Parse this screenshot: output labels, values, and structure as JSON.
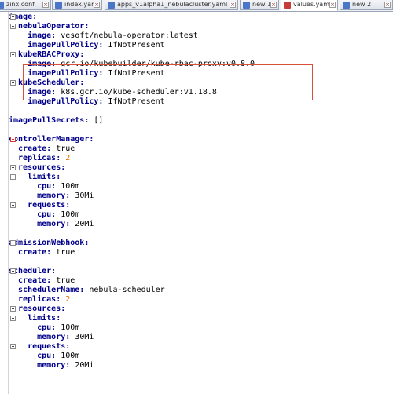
{
  "tabs": [
    {
      "label": "zinx.conf",
      "active": false
    },
    {
      "label": "index.yaml",
      "active": false
    },
    {
      "label": "apps_v1alpha1_nebulacluster.yaml",
      "active": false
    },
    {
      "label": "new 1",
      "active": false
    },
    {
      "label": "values.yaml",
      "active": true
    },
    {
      "label": "new 2",
      "active": false
    }
  ],
  "code_lines": [
    [
      {
        "t": "image:",
        "c": "k"
      }
    ],
    [
      {
        "t": "  nebulaOperator:",
        "c": "k"
      }
    ],
    [
      {
        "t": "    image:",
        "c": "k"
      },
      {
        "t": " vesoft/nebula-operator:latest",
        "c": "s"
      }
    ],
    [
      {
        "t": "    imagePullPolicy:",
        "c": "k"
      },
      {
        "t": " IfNotPresent",
        "c": "s"
      }
    ],
    [
      {
        "t": "  kubeRBACProxy:",
        "c": "k"
      }
    ],
    [
      {
        "t": "    image:",
        "c": "k"
      },
      {
        "t": " gcr.io/kubebuilder/kube-rbac-proxy:v0.8.0",
        "c": "s"
      }
    ],
    [
      {
        "t": "    imagePullPolicy:",
        "c": "k"
      },
      {
        "t": " IfNotPresent",
        "c": "s"
      }
    ],
    [
      {
        "t": "  kubeScheduler:",
        "c": "k"
      }
    ],
    [
      {
        "t": "    image:",
        "c": "k"
      },
      {
        "t": " k8s.gcr.io/kube-scheduler:v1.18.8",
        "c": "s"
      }
    ],
    [
      {
        "t": "    imagePullPolicy:",
        "c": "k"
      },
      {
        "t": " IfNotPresent",
        "c": "s"
      }
    ],
    [],
    [
      {
        "t": "imagePullSecrets:",
        "c": "k"
      },
      {
        "t": " []",
        "c": "s"
      }
    ],
    [],
    [
      {
        "t": "controllerManager:",
        "c": "k"
      }
    ],
    [
      {
        "t": "  create:",
        "c": "k"
      },
      {
        "t": " true",
        "c": "s"
      }
    ],
    [
      {
        "t": "  replicas:",
        "c": "k"
      },
      {
        "t": " 2",
        "c": "n"
      }
    ],
    [
      {
        "t": "  resources:",
        "c": "k"
      }
    ],
    [
      {
        "t": "    limits:",
        "c": "k"
      }
    ],
    [
      {
        "t": "      cpu:",
        "c": "k"
      },
      {
        "t": " 100m",
        "c": "s"
      }
    ],
    [
      {
        "t": "      memory:",
        "c": "k"
      },
      {
        "t": " 30Mi",
        "c": "s"
      }
    ],
    [
      {
        "t": "    requests:",
        "c": "k"
      }
    ],
    [
      {
        "t": "      cpu:",
        "c": "k"
      },
      {
        "t": " 100m",
        "c": "s"
      }
    ],
    [
      {
        "t": "      memory:",
        "c": "k"
      },
      {
        "t": " 20Mi",
        "c": "s"
      }
    ],
    [],
    [
      {
        "t": "admissionWebhook:",
        "c": "k"
      }
    ],
    [
      {
        "t": "  create:",
        "c": "k"
      },
      {
        "t": " true",
        "c": "s"
      }
    ],
    [],
    [
      {
        "t": "scheduler:",
        "c": "k"
      }
    ],
    [
      {
        "t": "  create:",
        "c": "k"
      },
      {
        "t": " true",
        "c": "s"
      }
    ],
    [
      {
        "t": "  schedulerName:",
        "c": "k"
      },
      {
        "t": " nebula-scheduler",
        "c": "s"
      }
    ],
    [
      {
        "t": "  replicas:",
        "c": "k"
      },
      {
        "t": " 2",
        "c": "n"
      }
    ],
    [
      {
        "t": "  resources:",
        "c": "k"
      }
    ],
    [
      {
        "t": "    limits:",
        "c": "k"
      }
    ],
    [
      {
        "t": "      cpu:",
        "c": "k"
      },
      {
        "t": " 100m",
        "c": "s"
      }
    ],
    [
      {
        "t": "      memory:",
        "c": "k"
      },
      {
        "t": " 30Mi",
        "c": "s"
      }
    ],
    [
      {
        "t": "    requests:",
        "c": "k"
      }
    ],
    [
      {
        "t": "      cpu:",
        "c": "k"
      },
      {
        "t": " 100m",
        "c": "s"
      }
    ],
    [
      {
        "t": "      memory:",
        "c": "k"
      },
      {
        "t": " 20Mi",
        "c": "s"
      }
    ]
  ],
  "fold_markers": [
    {
      "line": 0,
      "color": "normal"
    },
    {
      "line": 1,
      "color": "normal"
    },
    {
      "line": 4,
      "color": "normal"
    },
    {
      "line": 7,
      "color": "normal"
    },
    {
      "line": 13,
      "color": "red"
    },
    {
      "line": 16,
      "color": "normal"
    },
    {
      "line": 17,
      "color": "normal"
    },
    {
      "line": 20,
      "color": "normal"
    },
    {
      "line": 24,
      "color": "normal"
    },
    {
      "line": 27,
      "color": "normal"
    },
    {
      "line": 31,
      "color": "normal"
    },
    {
      "line": 32,
      "color": "normal"
    },
    {
      "line": 35,
      "color": "normal"
    }
  ],
  "colors": {
    "key": "#00008b",
    "number": "#e07000",
    "highlight_box": "#d9503a",
    "fold_active": "#d23b3b"
  }
}
